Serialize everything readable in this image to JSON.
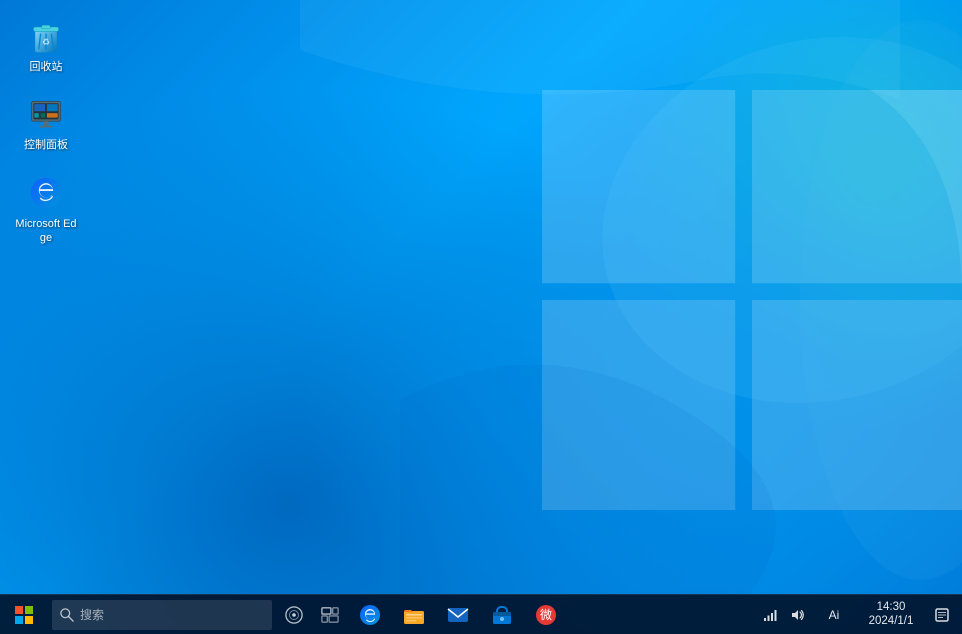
{
  "desktop": {
    "icons": [
      {
        "id": "recycle-bin",
        "label": "回收站",
        "type": "recycle-bin"
      },
      {
        "id": "control-panel",
        "label": "控制面板",
        "type": "control-panel"
      },
      {
        "id": "microsoft-edge",
        "label": "Microsoft Edge",
        "type": "edge"
      }
    ]
  },
  "taskbar": {
    "search_placeholder": "搜索",
    "clock": {
      "time": "14:30",
      "date": "2024/1/1"
    },
    "input_indicator": "Ai",
    "pinned_apps": [
      {
        "id": "edge",
        "label": "Microsoft Edge"
      },
      {
        "id": "explorer",
        "label": "文件资源管理器"
      },
      {
        "id": "mail",
        "label": "邮件"
      },
      {
        "id": "store",
        "label": "Microsoft Store"
      },
      {
        "id": "weibo",
        "label": "微博"
      }
    ]
  }
}
